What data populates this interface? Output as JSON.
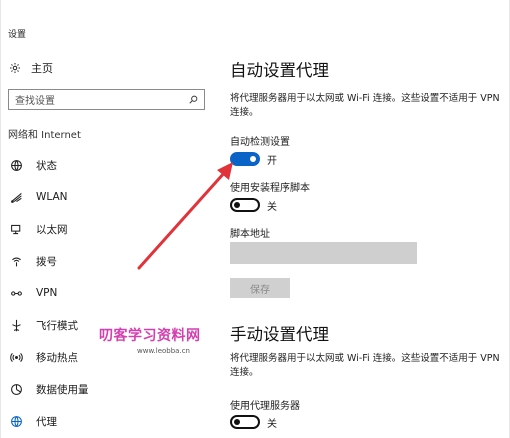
{
  "app": {
    "title": "设置"
  },
  "nav": {
    "home_label": "主页",
    "search_placeholder": "查找设置",
    "section_title": "网络和 Internet",
    "items": [
      {
        "label": "状态",
        "icon": "globe-icon"
      },
      {
        "label": "WLAN",
        "icon": "wifi-icon"
      },
      {
        "label": "以太网",
        "icon": "ethernet-icon"
      },
      {
        "label": "拨号",
        "icon": "dialup-icon"
      },
      {
        "label": "VPN",
        "icon": "vpn-icon"
      },
      {
        "label": "飞行模式",
        "icon": "airplane-icon"
      },
      {
        "label": "移动热点",
        "icon": "hotspot-icon"
      },
      {
        "label": "数据使用量",
        "icon": "data-usage-icon"
      },
      {
        "label": "代理",
        "icon": "proxy-globe-icon",
        "active": true
      }
    ]
  },
  "auto_proxy": {
    "title": "自动设置代理",
    "description": "将代理服务器用于以太网或 Wi-Fi 连接。这些设置不适用于 VPN 连接。",
    "detect_label": "自动检测设置",
    "detect_state": "开",
    "script_label": "使用安装程序脚本",
    "script_state": "关",
    "address_label": "脚本地址",
    "address_value": "",
    "save_label": "保存"
  },
  "manual_proxy": {
    "title": "手动设置代理",
    "description": "将代理服务器用于以太网或 Wi-Fi 连接。这些设置不适用于 VPN 连接。",
    "use_proxy_label": "使用代理服务器",
    "use_proxy_state": "关"
  },
  "watermark": {
    "text": "叨客学习资料网",
    "url": "www.leobba.cn"
  },
  "colors": {
    "accent": "#0a64c8",
    "arrow": "#e0333a",
    "watermark": "#d43fb0"
  }
}
